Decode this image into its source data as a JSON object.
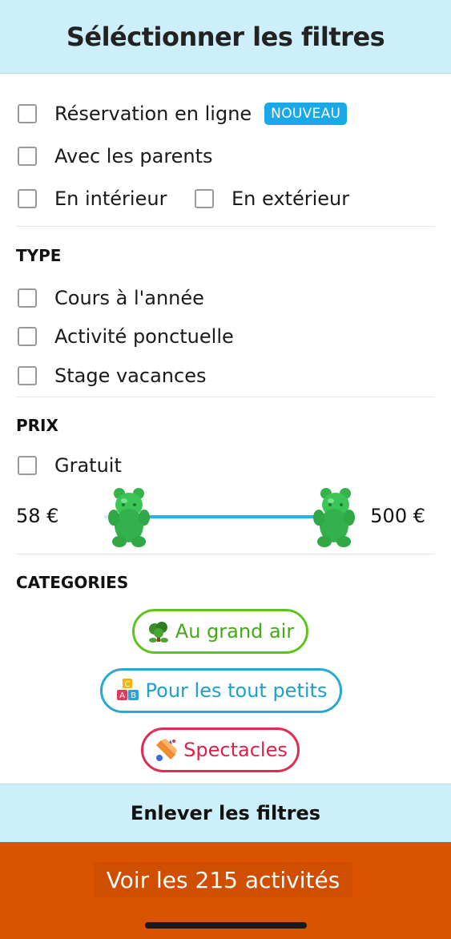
{
  "header": {
    "title": "Séléctionner les filtres"
  },
  "options": {
    "online_booking": {
      "label": "Réservation en ligne",
      "badge": "NOUVEAU"
    },
    "with_parents": {
      "label": "Avec les parents"
    },
    "indoor": {
      "label": "En intérieur"
    },
    "outdoor": {
      "label": "En extérieur"
    }
  },
  "type_section": {
    "title": "TYPE",
    "items": [
      {
        "label": "Cours à l'année"
      },
      {
        "label": "Activité ponctuelle"
      },
      {
        "label": "Stage vacances"
      }
    ]
  },
  "price_section": {
    "title": "PRIX",
    "free_label": "Gratuit",
    "min_label": "58 €",
    "max_label": "500 €",
    "min_value": 58,
    "max_value": 500,
    "slider_icon": "gummy-bear-icon",
    "slider_color": "#27b3e8"
  },
  "categories_section": {
    "title": "CATEGORIES",
    "items": [
      {
        "label": "Au grand air",
        "icon": "tree-icon",
        "color": "#5cc41c"
      },
      {
        "label": "Pour les tout petits",
        "icon": "abc-blocks-icon",
        "color": "#28a9cf"
      },
      {
        "label": "Spectacles",
        "icon": "performing-arts-icon",
        "color": "#e22a52"
      }
    ]
  },
  "footer": {
    "clear_label": "Enlever les filtres",
    "cta_label": "Voir les 215 activités",
    "cta_color": "#d95300"
  }
}
